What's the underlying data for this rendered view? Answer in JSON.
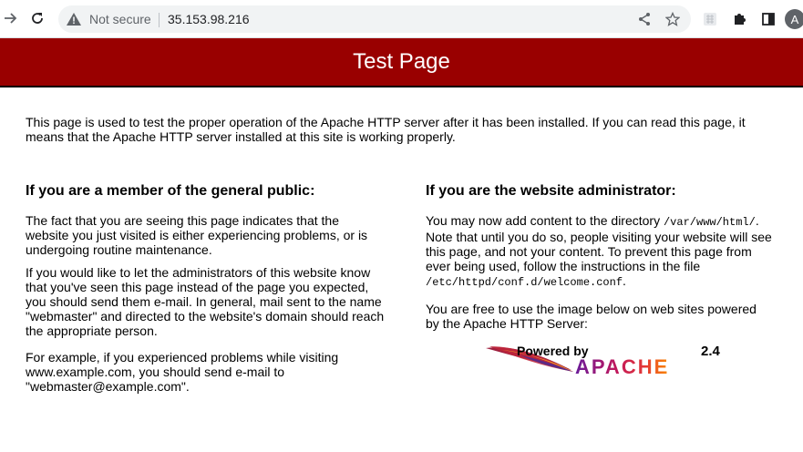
{
  "browser": {
    "security_label": "Not secure",
    "url": "35.153.98.216",
    "profile_initial": "A",
    "icons": [
      "back-icon",
      "reload-icon",
      "warning-icon",
      "share-icon",
      "bookmark-star-icon",
      "extension-grid-icon",
      "puzzle-icon",
      "side-panel-icon"
    ]
  },
  "page": {
    "title": "Test Page",
    "intro": "This page is used to test the proper operation of the Apache HTTP server after it has been installed. If you can read this page, it means that the Apache HTTP server installed at this site is working properly.",
    "public": {
      "heading": "If you are a member of the general public:",
      "p1": "The fact that you are seeing this page indicates that the website you just visited is either experiencing problems, or is undergoing routine maintenance.",
      "p2": "If you would like to let the administrators of this website know that you've seen this page instead of the page you expected, you should send them e-mail. In general, mail sent to the name \"webmaster\" and directed to the website's domain should reach the appropriate person.",
      "p3": "For example, if you experienced problems while visiting www.example.com, you should send e-mail to \"webmaster@example.com\"."
    },
    "admin": {
      "heading": "If you are the website administrator:",
      "p1_a": "You may now add content to the directory ",
      "p1_path": "/var/www/html/",
      "p1_b": ". Note that until you do so, people visiting your website will see this page, and not your content. To prevent this page from ever being used, follow the instructions in the file ",
      "p1_file": "/etc/httpd/conf.d/welcome.conf",
      "p1_c": ".",
      "p2": "You are free to use the image below on web sites powered by the Apache HTTP Server:"
    },
    "logo": {
      "powered_by": "Powered by",
      "version": "2.4",
      "brand": "APACHE"
    }
  },
  "colors": {
    "header_bg": "#990000",
    "omnibox_bg": "#f1f3f4"
  }
}
